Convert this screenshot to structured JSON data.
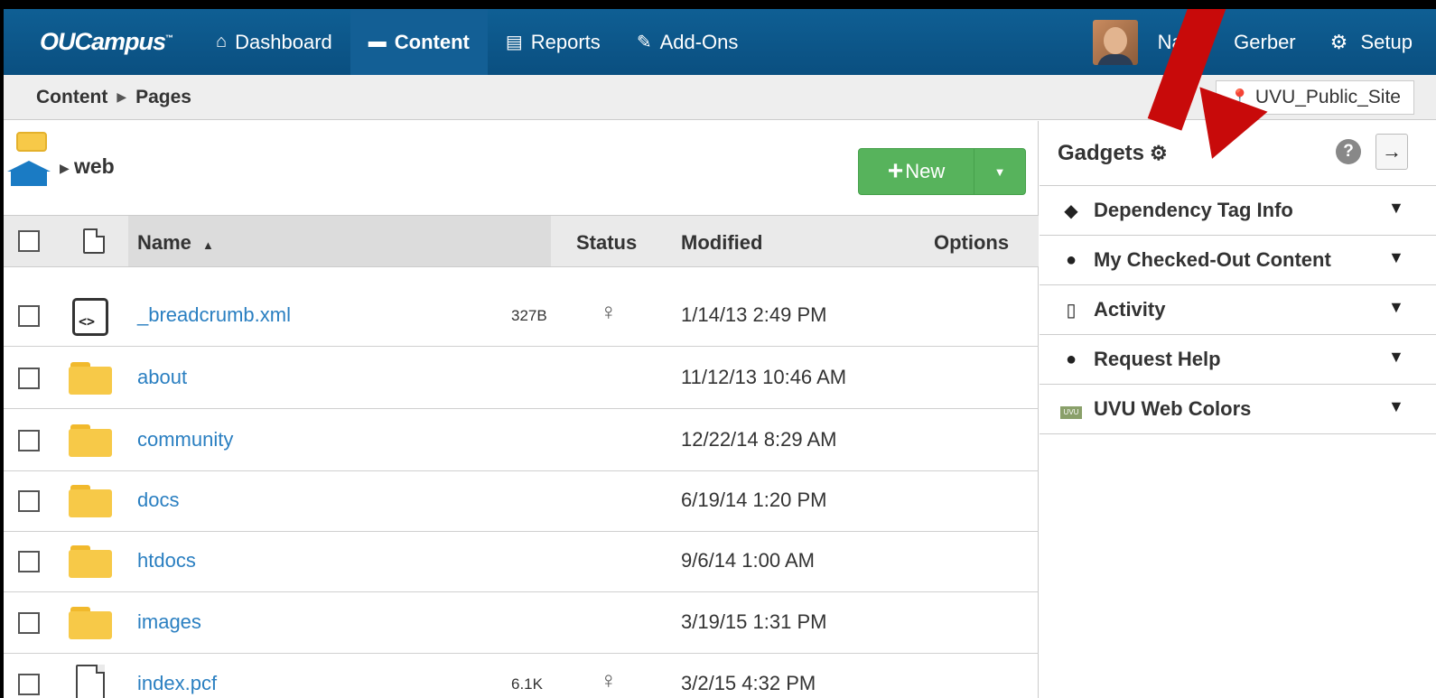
{
  "nav": {
    "brand": "OUCampus",
    "brand_tm": "™",
    "items": [
      {
        "label": "Dashboard",
        "icon": "home-icon",
        "glyph": "🏠"
      },
      {
        "label": "Content",
        "icon": "folder-icon",
        "glyph": "▬"
      },
      {
        "label": "Reports",
        "icon": "clipboard-icon",
        "glyph": "📋"
      },
      {
        "label": "Add-Ons",
        "icon": "pin-icon",
        "glyph": "📌"
      }
    ],
    "user": "Nathan Gerber",
    "user_visible": "Nath",
    "user_visible2": "Gerber",
    "setup": "Setup"
  },
  "breadcrumb": {
    "parent": "Content",
    "current": "Pages"
  },
  "site": "UVU_Public_Site",
  "path": {
    "label": "web"
  },
  "new_button": {
    "label": "New"
  },
  "table": {
    "headers": {
      "name": "Name",
      "sort_indicator": "▲",
      "status": "Status",
      "modified": "Modified",
      "options": "Options"
    },
    "rows": [
      {
        "type": "file",
        "name": "_breadcrumb.xml",
        "size": "327B",
        "status": "lightbulb",
        "modified": "1/14/13 2:49 PM"
      },
      {
        "type": "folder",
        "name": "about",
        "size": "",
        "status": "",
        "modified": "11/12/13 10:46 AM"
      },
      {
        "type": "folder",
        "name": "community",
        "size": "",
        "status": "",
        "modified": "12/22/14 8:29 AM"
      },
      {
        "type": "folder",
        "name": "docs",
        "size": "",
        "status": "",
        "modified": "6/19/14 1:20 PM"
      },
      {
        "type": "folder",
        "name": "htdocs",
        "size": "",
        "status": "",
        "modified": "9/6/14 1:00 AM"
      },
      {
        "type": "folder",
        "name": "images",
        "size": "",
        "status": "",
        "modified": "3/19/15 1:31 PM"
      },
      {
        "type": "page",
        "name": "index.pcf",
        "size": "6.1K",
        "status": "lightbulb",
        "modified": "3/2/15 4:32 PM"
      }
    ]
  },
  "gadgets": {
    "title": "Gadgets",
    "help": "?",
    "collapse": "→",
    "items": [
      {
        "label": "Dependency Tag Info",
        "icon": "tag-icon",
        "glyph": "🏷"
      },
      {
        "label": "My Checked-Out Content",
        "icon": "lightbulb-icon",
        "glyph": "💡"
      },
      {
        "label": "Activity",
        "icon": "mouse-icon",
        "glyph": "🖱"
      },
      {
        "label": "Request Help",
        "icon": "speech-bubble-icon",
        "glyph": "💬"
      },
      {
        "label": "UVU Web Colors",
        "icon": "uvu-colors-icon",
        "glyph": "UVU"
      }
    ]
  },
  "colors": {
    "nav_bg": "#0a4f80",
    "link": "#2a7fc1",
    "new_button": "#57b35c",
    "folder": "#f7c948",
    "arrow": "#c80a0a"
  }
}
